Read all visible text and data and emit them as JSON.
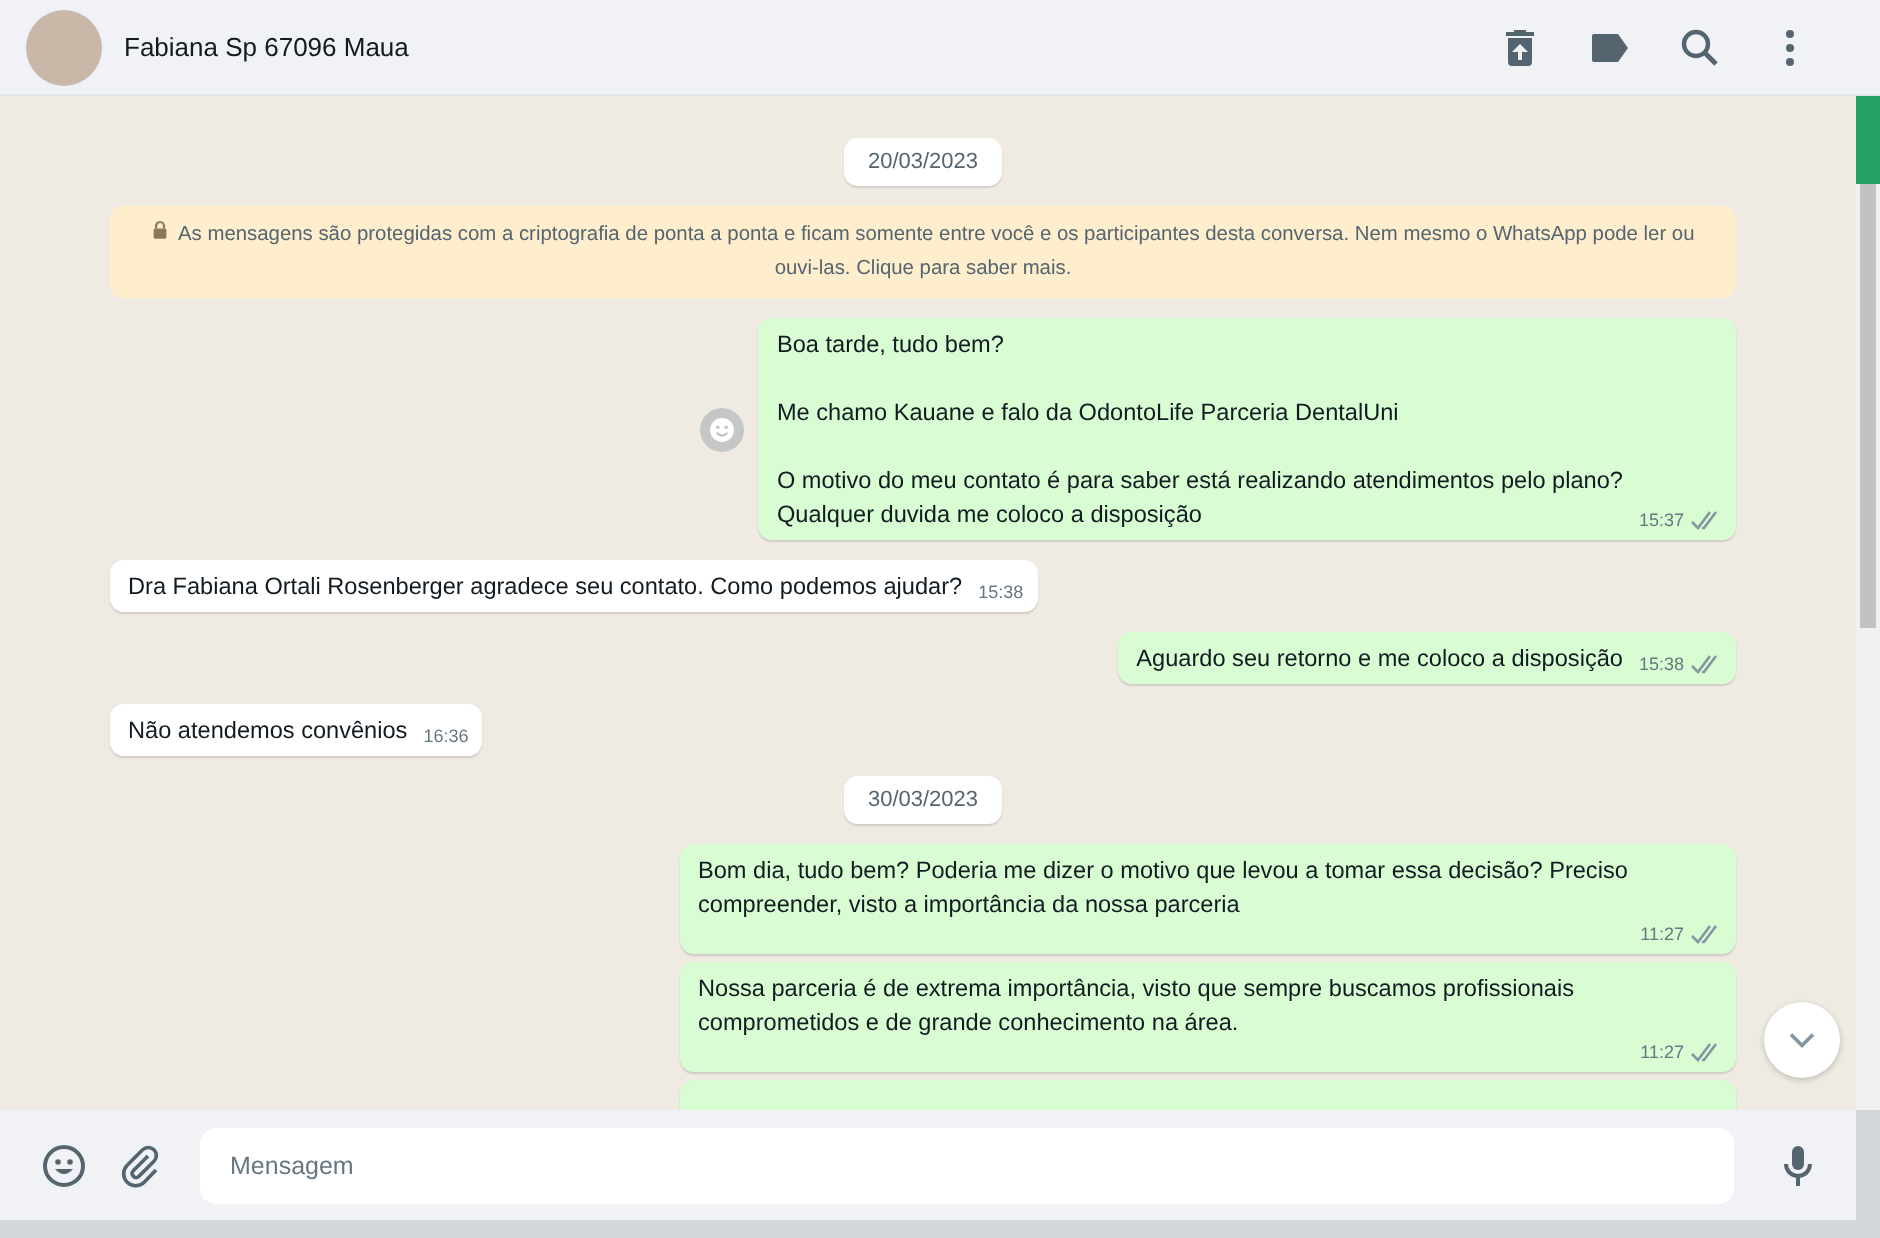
{
  "header": {
    "contact_name": "Fabiana Sp 67096 Maua"
  },
  "messages": [
    {
      "kind": "date",
      "text": "20/03/2023"
    },
    {
      "kind": "notice",
      "text": "As mensagens são protegidas com a criptografia de ponta a ponta e ficam somente entre você e os participantes desta conversa. Nem mesmo o WhatsApp pode ler ou ouvi-las. Clique para saber mais."
    },
    {
      "kind": "outgoing",
      "text": "Boa tarde, tudo bem?\n\nMe chamo Kauane e falo da OdontoLife Parceria DentalUni\n\nO motivo do meu contato é para saber está realizando atendimentos pelo plano?\nQualquer duvida me coloco a disposição",
      "time": "15:37",
      "read": false,
      "reaction_button": true
    },
    {
      "kind": "incoming",
      "text": "Dra Fabiana Ortali Rosenberger agradece seu contato. Como podemos ajudar?",
      "time": "15:38"
    },
    {
      "kind": "outgoing",
      "text": "Aguardo seu retorno e me coloco a disposição",
      "time": "15:38",
      "read": false
    },
    {
      "kind": "incoming",
      "text": "Não atendemos convênios",
      "time": "16:36"
    },
    {
      "kind": "date",
      "text": "30/03/2023"
    },
    {
      "kind": "outgoing",
      "text": "Bom dia, tudo bem? Poderia me dizer o motivo que levou a tomar essa decisão? Preciso compreender, visto a importância da nossa parceria",
      "time": "11:27",
      "read": false
    },
    {
      "kind": "outgoing",
      "text": "Nossa parceria é de extrema importância, visto que sempre buscamos profissionais comprometidos e de grande conhecimento na área.",
      "time": "11:27",
      "read": false
    }
  ],
  "composer": {
    "placeholder": "Mensagem"
  }
}
